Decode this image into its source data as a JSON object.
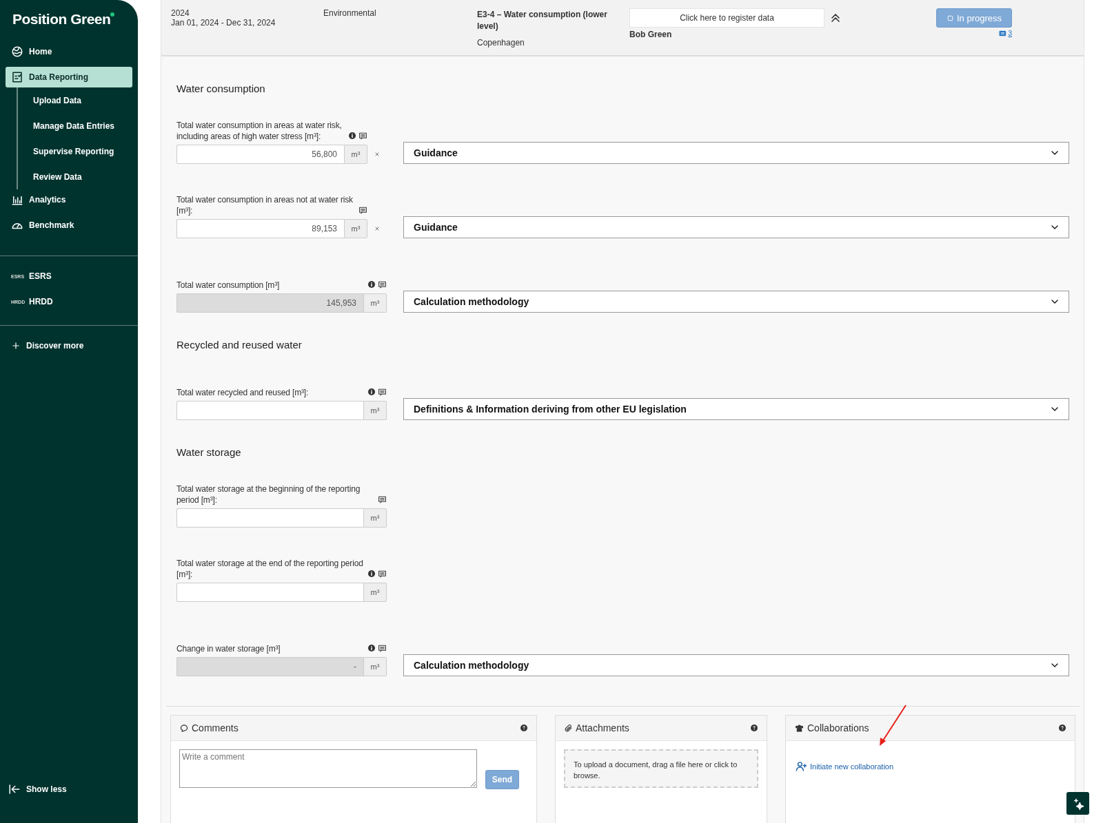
{
  "sidebar": {
    "logo": "Position Green",
    "groups": [
      {
        "items": [
          {
            "label": "Home",
            "selected": false
          },
          {
            "label": "Data Reporting",
            "selected": true,
            "children": [
              {
                "label": "Upload Data"
              },
              {
                "label": "Manage Data Entries"
              },
              {
                "label": "Supervise Reporting"
              },
              {
                "label": "Review Data"
              }
            ]
          },
          {
            "label": "Analytics",
            "selected": false
          },
          {
            "label": "Benchmark",
            "selected": false
          }
        ]
      },
      {
        "items": [
          {
            "badge": "ESRS",
            "label": "ESRS",
            "selected": false
          },
          {
            "badge": "HRDD",
            "label": "HRDD",
            "selected": false
          }
        ]
      },
      {
        "items": [
          {
            "label": "Discover more",
            "selected": false
          }
        ]
      }
    ],
    "show_less": "Show less"
  },
  "header": {
    "year": "2024",
    "period": "Jan 01, 2024 - Dec 31, 2024",
    "category": "Environmental",
    "title": "E3-4 – Water consumption (lower level)",
    "location": "Copenhagen",
    "register_button": "Click here to register data",
    "assignee": "Bob Green",
    "status": "In progress",
    "comment_count": "3"
  },
  "sections": [
    {
      "title": "Water consumption",
      "fields": [
        {
          "label": "Total water consumption in areas at water risk, including areas of high water stress [m³]:",
          "value": "56,800",
          "unit": "m³",
          "readonly": false,
          "info": true,
          "clearable": true,
          "dropdown": "Guidance"
        },
        {
          "label": "Total water consumption in areas not at water risk [m³]:",
          "value": "89,153",
          "unit": "m³",
          "readonly": false,
          "info": false,
          "clearable": true,
          "dropdown": "Guidance"
        },
        {
          "label": "Total water consumption [m³]",
          "value": "145,953",
          "unit": "m³",
          "readonly": true,
          "info": true,
          "clearable": false,
          "dropdown": "Calculation methodology"
        }
      ]
    },
    {
      "title": "Recycled and reused water",
      "fields": [
        {
          "label": "Total water recycled and reused [m³]:",
          "unit": "m³",
          "readonly": false,
          "info": true,
          "clearable": false,
          "dropdown": "Definitions & Information deriving from other EU legislation"
        }
      ]
    },
    {
      "title": "Water storage",
      "fields": [
        {
          "label": "Total water storage at the beginning of the reporting period [m³]:",
          "unit": "m³",
          "readonly": false,
          "info": false,
          "clearable": false
        },
        {
          "label": "Total water storage at the end of the reporting period [m³]:",
          "unit": "m³",
          "readonly": false,
          "info": true,
          "clearable": false
        },
        {
          "label": "Change in water storage [m³]",
          "value": "-",
          "unit": "m³",
          "readonly": true,
          "info": true,
          "clearable": false,
          "dropdown": "Calculation methodology"
        }
      ]
    }
  ],
  "panels": {
    "comments": {
      "title": "Comments",
      "placeholder": "Write a comment",
      "send": "Send"
    },
    "attachments": {
      "title": "Attachments",
      "drop_text": "To upload a document, drag a file here or click to browse."
    },
    "collaborations": {
      "title": "Collaborations",
      "link": "Initiate new collaboration"
    }
  }
}
